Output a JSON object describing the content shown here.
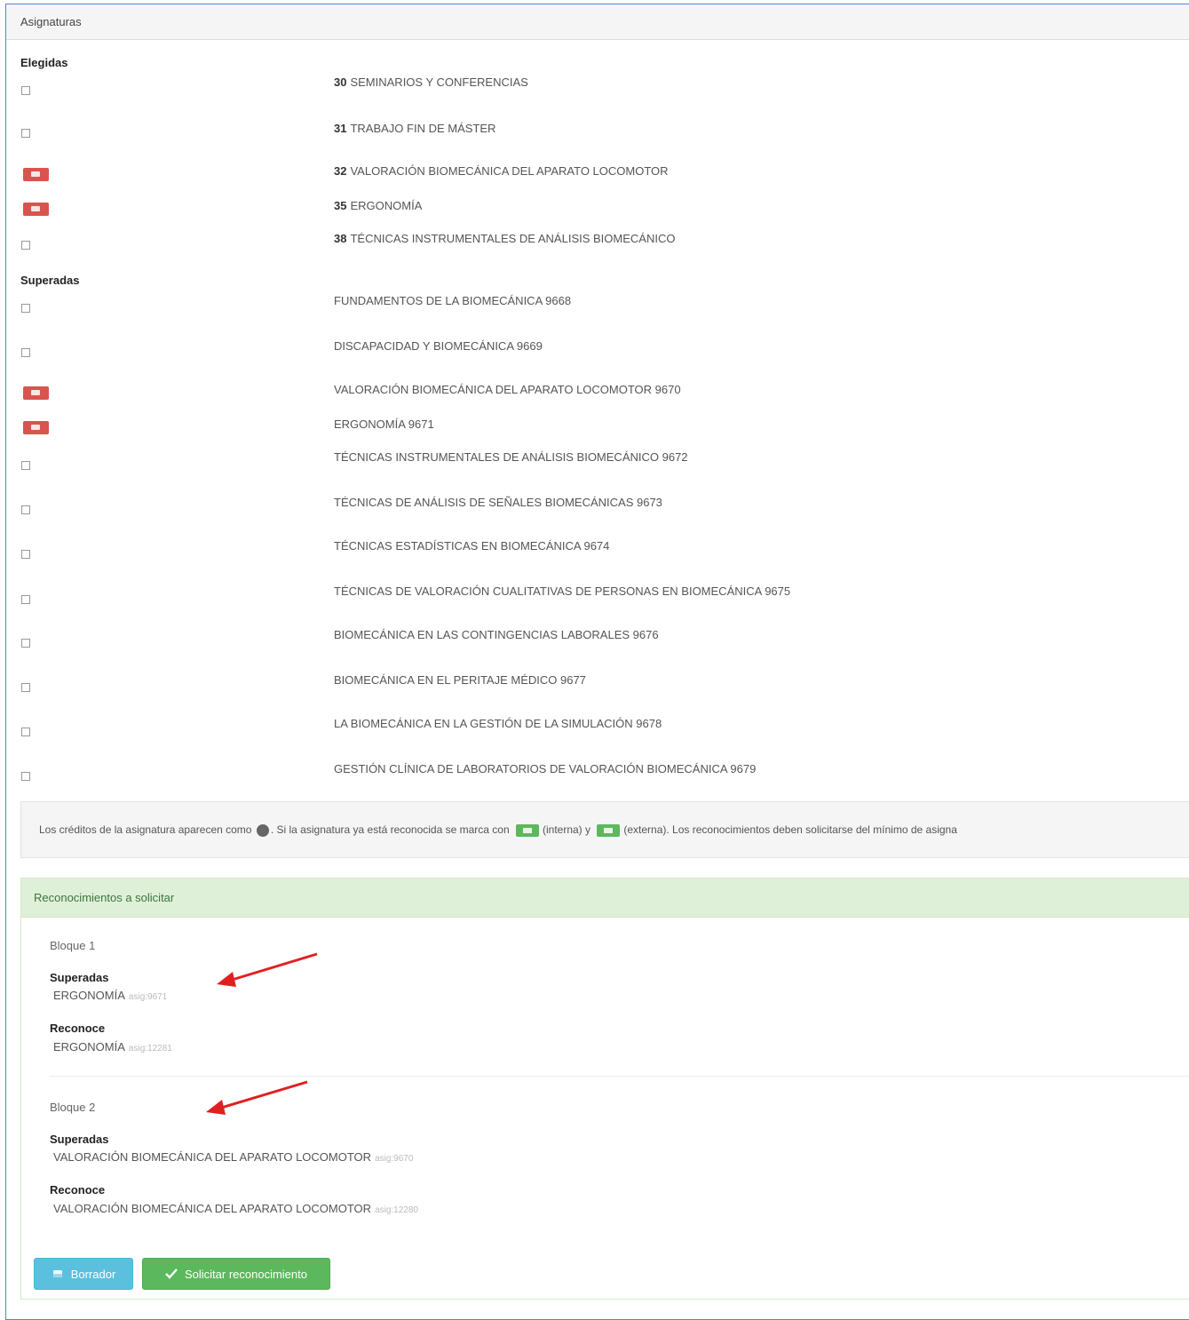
{
  "panel": {
    "title": "Asignaturas"
  },
  "elegidas": {
    "label": "Elegidas",
    "items": [
      {
        "num": "30",
        "name": "SEMINARIOS Y CONFERENCIAS",
        "status": "unchecked"
      },
      {
        "num": "31",
        "name": "TRABAJO FIN DE MÁSTER",
        "status": "unchecked"
      },
      {
        "num": "32",
        "name": "VALORACIÓN BIOMECÁNICA DEL APARATO LOCOMOTOR",
        "status": "recognized-red"
      },
      {
        "num": "35",
        "name": "ERGONOMÍA",
        "status": "recognized-red"
      },
      {
        "num": "38",
        "name": "TÉCNICAS INSTRUMENTALES DE ANÁLISIS BIOMECÁNICO",
        "status": "unchecked"
      }
    ]
  },
  "superadas": {
    "label": "Superadas",
    "items": [
      {
        "name": "FUNDAMENTOS DE LA BIOMECÁNICA 9668",
        "status": "unchecked"
      },
      {
        "name": "DISCAPACIDAD Y BIOMECÁNICA 9669",
        "status": "unchecked"
      },
      {
        "name": "VALORACIÓN BIOMECÁNICA DEL APARATO LOCOMOTOR 9670",
        "status": "recognized-red"
      },
      {
        "name": "ERGONOMÍA 9671",
        "status": "recognized-red"
      },
      {
        "name": "TÉCNICAS INSTRUMENTALES DE ANÁLISIS BIOMECÁNICO 9672",
        "status": "unchecked"
      },
      {
        "name": "TÉCNICAS DE ANÁLISIS DE SEÑALES BIOMECÁNICAS 9673",
        "status": "unchecked"
      },
      {
        "name": "TÉCNICAS ESTADÍSTICAS EN BIOMECÁNICA 9674",
        "status": "unchecked"
      },
      {
        "name": "TÉCNICAS DE VALORACIÓN CUALITATIVAS DE PERSONAS EN BIOMECÁNICA 9675",
        "status": "unchecked"
      },
      {
        "name": "BIOMECÁNICA EN LAS CONTINGENCIAS LABORALES 9676",
        "status": "unchecked"
      },
      {
        "name": "BIOMECÁNICA EN EL PERITAJE MÉDICO 9677",
        "status": "unchecked"
      },
      {
        "name": "LA BIOMECÁNICA EN LA GESTIÓN DE LA SIMULACIÓN 9678",
        "status": "unchecked"
      },
      {
        "name": "GESTIÓN CLÍNICA DE LABORATORIOS DE VALORACIÓN BIOMECÁNICA 9679",
        "status": "unchecked"
      }
    ]
  },
  "info": {
    "part1": "Los créditos de la asignatura aparecen como",
    "part2": ". Si la asignatura ya está reconocida se marca con",
    "interna": "(interna) y",
    "externa": "(externa). Los reconocimientos deben solicitarse del mínimo de asigna"
  },
  "reconocimientos": {
    "title": "Reconocimientos a solicitar",
    "blocks": [
      {
        "title": "Bloque 1",
        "superadas_label": "Superadas",
        "superada": {
          "name": "ERGONOMÍA",
          "code": "asig:9671"
        },
        "reconoce_label": "Reconoce",
        "reconoce": {
          "name": "ERGONOMÍA",
          "code": "asig:12281"
        }
      },
      {
        "title": "Bloque 2",
        "superadas_label": "Superadas",
        "superada": {
          "name": "VALORACIÓN BIOMECÁNICA DEL APARATO LOCOMOTOR",
          "code": "asig:9670"
        },
        "reconoce_label": "Reconoce",
        "reconoce": {
          "name": "VALORACIÓN BIOMECÁNICA DEL APARATO LOCOMOTOR",
          "code": "asig:12280"
        }
      }
    ]
  },
  "buttons": {
    "borrador": "Borrador",
    "solicitar": "Solicitar reconocimiento"
  },
  "colors": {
    "danger": "#d9534f",
    "success": "#5cb85c",
    "info": "#5bc0de",
    "success_panel": "#dff0d8",
    "annotation_arrow": "#e02020"
  }
}
